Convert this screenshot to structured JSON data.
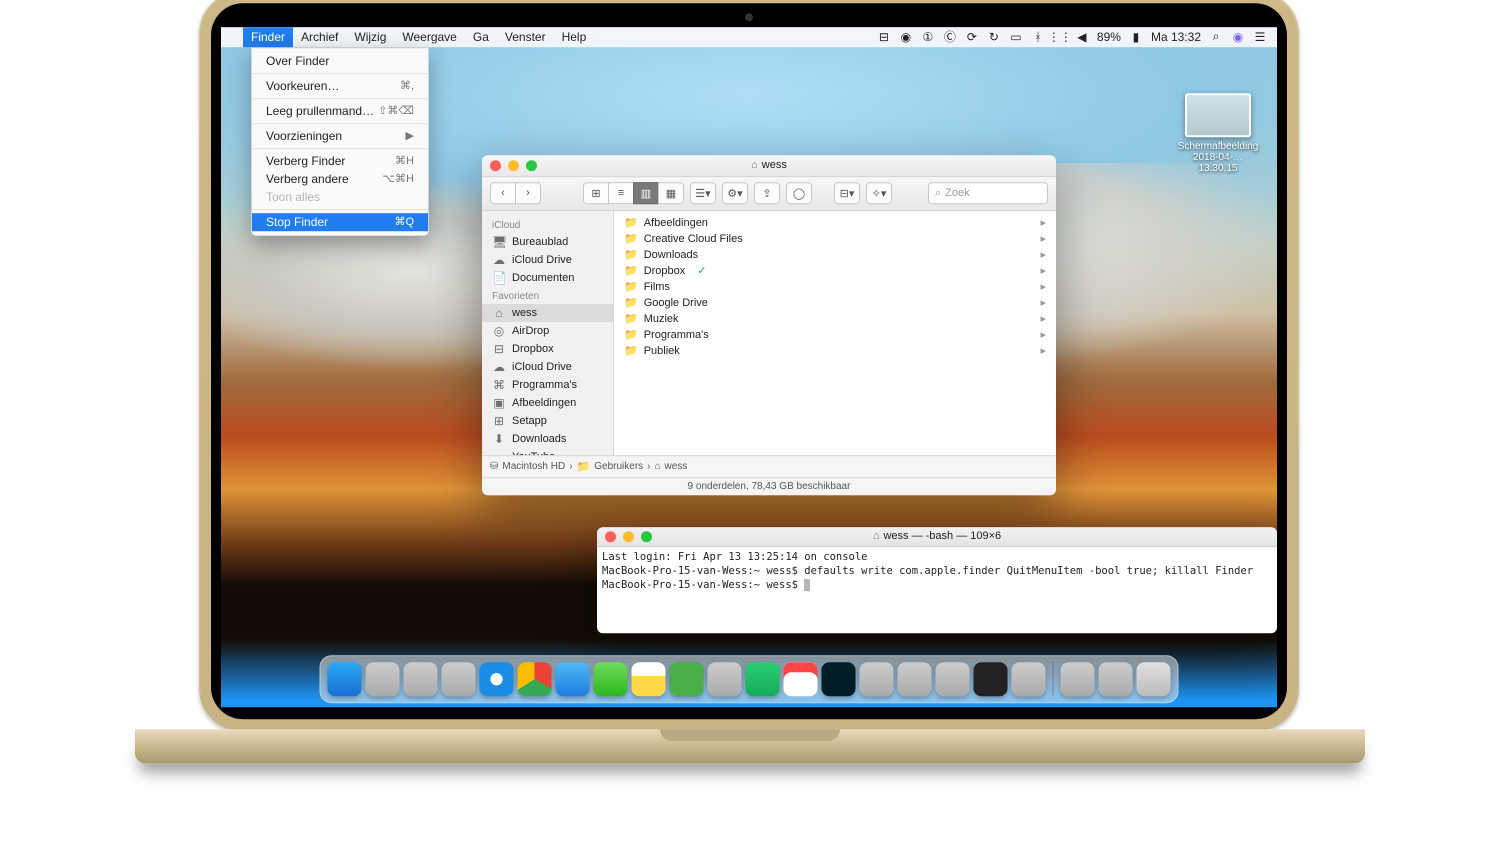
{
  "menubar": {
    "appName": "Finder",
    "items": [
      "Archief",
      "Wijzig",
      "Weergave",
      "Ga",
      "Venster",
      "Help"
    ],
    "right": {
      "battery": "89%",
      "chargeIcon": "⚡︎",
      "clock": "Ma 13:32"
    }
  },
  "finderMenu": [
    {
      "label": "Over Finder",
      "shortcut": ""
    },
    {
      "sep": true
    },
    {
      "label": "Voorkeuren…",
      "shortcut": "⌘,"
    },
    {
      "sep": true
    },
    {
      "label": "Leeg prullenmand…",
      "shortcut": "⇧⌘⌫"
    },
    {
      "sep": true
    },
    {
      "label": "Voorzieningen",
      "shortcut": "▶"
    },
    {
      "sep": true
    },
    {
      "label": "Verberg Finder",
      "shortcut": "⌘H"
    },
    {
      "label": "Verberg andere",
      "shortcut": "⌥⌘H"
    },
    {
      "label": "Toon alles",
      "shortcut": "",
      "disabled": true
    },
    {
      "sep": true
    },
    {
      "label": "Stop Finder",
      "shortcut": "⌘Q",
      "selected": true
    }
  ],
  "finder": {
    "title": "wess",
    "search_placeholder": "Zoek",
    "sidebar": {
      "groups": [
        {
          "header": "iCloud",
          "items": [
            {
              "icon": "🖥",
              "label": "Bureaublad"
            },
            {
              "icon": "☁",
              "label": "iCloud Drive"
            },
            {
              "icon": "📄",
              "label": "Documenten"
            }
          ]
        },
        {
          "header": "Favorieten",
          "items": [
            {
              "icon": "⌂",
              "label": "wess",
              "selected": true
            },
            {
              "icon": "◎",
              "label": "AirDrop"
            },
            {
              "icon": "⊟",
              "label": "Dropbox"
            },
            {
              "icon": "☁",
              "label": "iCloud Drive"
            },
            {
              "icon": "⌘",
              "label": "Programma's"
            },
            {
              "icon": "▣",
              "label": "Afbeeldingen"
            },
            {
              "icon": "⊞",
              "label": "Setapp"
            },
            {
              "icon": "⬇",
              "label": "Downloads"
            },
            {
              "icon": "▭",
              "label": "YouTube"
            }
          ]
        }
      ]
    },
    "column": [
      {
        "label": "Afbeeldingen"
      },
      {
        "label": "Creative Cloud Files"
      },
      {
        "label": "Downloads"
      },
      {
        "label": "Dropbox",
        "sync": true
      },
      {
        "label": "Films"
      },
      {
        "label": "Google Drive"
      },
      {
        "label": "Muziek"
      },
      {
        "label": "Programma's"
      },
      {
        "label": "Publiek"
      }
    ],
    "path": [
      "Macintosh HD",
      "Gebruikers",
      "wess"
    ],
    "status": "9 onderdelen, 78,43 GB beschikbaar"
  },
  "terminal": {
    "title": "wess — -bash — 109×6",
    "lines": [
      "Last login: Fri Apr 13 13:25:14 on console",
      "MacBook-Pro-15-van-Wess:~ wess$ defaults write com.apple.finder QuitMenuItem -bool true; killall Finder",
      "MacBook-Pro-15-van-Wess:~ wess$ "
    ]
  },
  "desktop_item": {
    "line1": "Schermafbeelding",
    "line2": "2018-04-… 13.30.15"
  },
  "dock": [
    "finder",
    "launchpad",
    "siri",
    "appstore",
    "safari",
    "chrome",
    "mail",
    "messages",
    "notes",
    "evernote",
    "slack",
    "spotify",
    "calendar",
    "photoshop",
    "premiere",
    "imovie",
    "itunes",
    "terminal",
    "preview",
    "dropbox",
    "folder",
    "trash"
  ]
}
